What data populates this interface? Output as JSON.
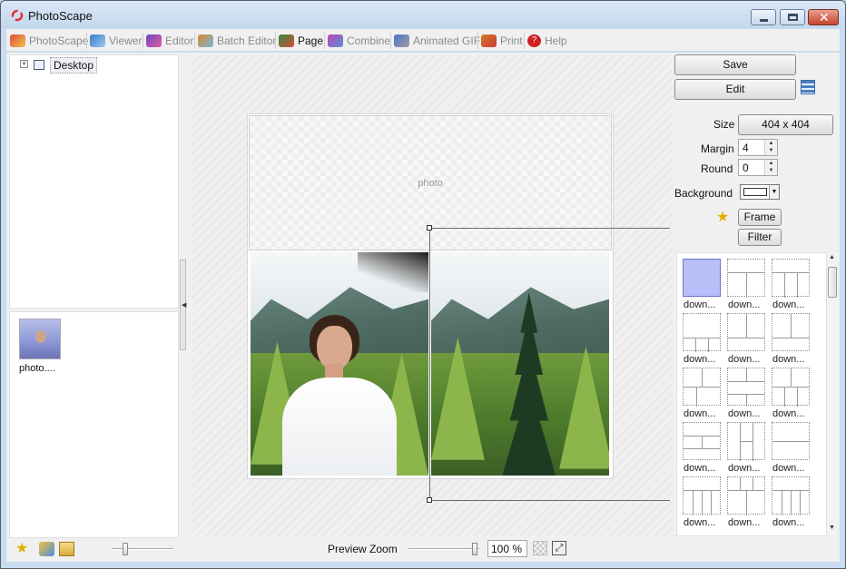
{
  "window": {
    "title": "PhotoScape"
  },
  "tabs": [
    {
      "label": "PhotoScape",
      "icon": "photoscape-icon",
      "color": "#c8382b"
    },
    {
      "label": "Viewer",
      "icon": "viewer-icon",
      "color": "#3b7dc9"
    },
    {
      "label": "Editor",
      "icon": "editor-icon",
      "color": "#6b4ac4"
    },
    {
      "label": "Batch Editor",
      "icon": "batch-editor-icon",
      "color": "#d58a2a"
    },
    {
      "label": "Page",
      "icon": "page-icon",
      "color": "#2f8d3e"
    },
    {
      "label": "Combine",
      "icon": "combine-icon",
      "color": "#b948b0"
    },
    {
      "label": "Animated GIF",
      "icon": "animated-gif-icon",
      "color": "#4d6fd0"
    },
    {
      "label": "Print",
      "icon": "print-icon",
      "color": "#d47a1e"
    },
    {
      "label": "Help",
      "icon": "help-icon",
      "color": "#d02020"
    }
  ],
  "active_tab": "Page",
  "tree": {
    "root_label": "Desktop"
  },
  "thumbnails": [
    {
      "label": "photo...."
    }
  ],
  "canvas": {
    "placeholder_text": "photo"
  },
  "right_panel": {
    "save_label": "Save",
    "edit_label": "Edit",
    "size_label": "Size",
    "size_value": "404 x 404",
    "margin_label": "Margin",
    "margin_value": "4",
    "round_label": "Round",
    "round_value": "0",
    "background_label": "Background",
    "background_color": "#ffffff",
    "frame_label": "Frame",
    "filter_label": "Filter"
  },
  "layouts": [
    {
      "label": "down..."
    },
    {
      "label": "down..."
    },
    {
      "label": "down..."
    },
    {
      "label": "down..."
    },
    {
      "label": "down..."
    },
    {
      "label": "down..."
    },
    {
      "label": "down..."
    },
    {
      "label": "down..."
    },
    {
      "label": "down..."
    },
    {
      "label": "down..."
    },
    {
      "label": "down..."
    },
    {
      "label": "down..."
    },
    {
      "label": "down..."
    },
    {
      "label": "down..."
    },
    {
      "label": "down..."
    }
  ],
  "bottom_bar": {
    "preview_zoom_label": "Preview Zoom",
    "zoom_value": "100 %",
    "zoom_level": 1.0
  }
}
